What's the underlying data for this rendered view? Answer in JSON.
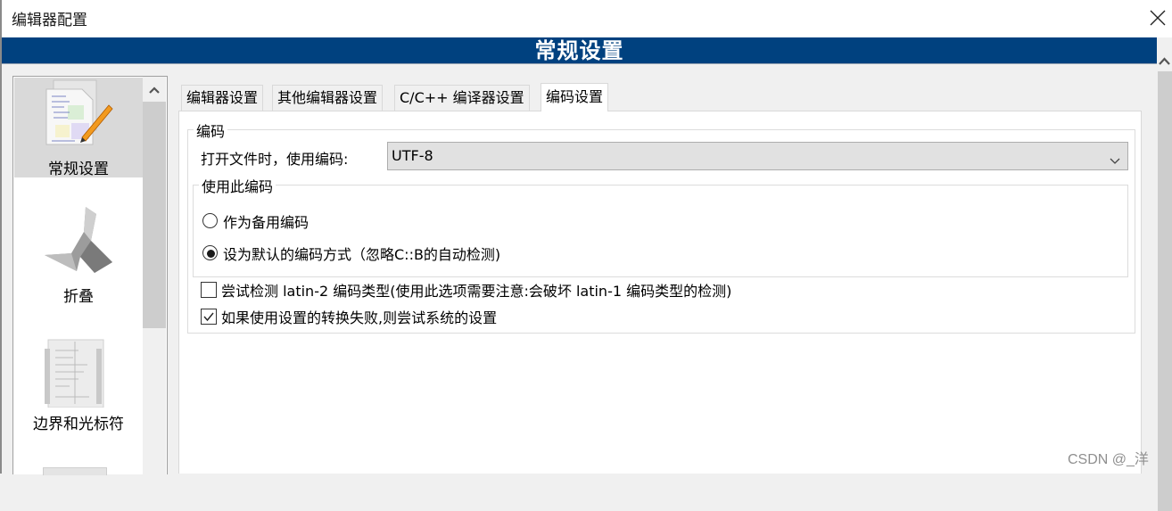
{
  "window": {
    "title": "编辑器配置",
    "close_icon": "close-icon"
  },
  "banner": {
    "title": "常规设置"
  },
  "sidebar": {
    "items": [
      {
        "label": "常规设置",
        "icon": "document-pencil-icon",
        "selected": true
      },
      {
        "label": "折叠",
        "icon": "origami-fold-icon",
        "selected": false
      },
      {
        "label": "边界和光标符",
        "icon": "margin-document-icon",
        "selected": false
      }
    ]
  },
  "tabs": [
    {
      "label": "编辑器设置",
      "active": false
    },
    {
      "label": "其他编辑器设置",
      "active": false
    },
    {
      "label": "C/C++ 编译器设置",
      "active": false
    },
    {
      "label": "编码设置",
      "active": true
    }
  ],
  "encoding": {
    "group_label": "编码",
    "open_file_label": "打开文件时，使用编码:",
    "encoding_value": "UTF-8",
    "use_group_label": "使用此编码",
    "radios": [
      {
        "label": "作为备用编码",
        "checked": false
      },
      {
        "label": "设为默认的编码方式（忽略C::B的自动检测)",
        "checked": true
      }
    ],
    "checkboxes": [
      {
        "label": "尝试检测 latin-2 编码类型(使用此选项需要注意:会破坏 latin-1 编码类型的检测)",
        "checked": false
      },
      {
        "label": "如果使用设置的转换失败,则尝试系统的设置",
        "checked": true
      }
    ]
  },
  "watermark": "CSDN @_洋",
  "colors": {
    "banner": "#00417f",
    "selected_item": "#d9d9d9",
    "combo_bg": "#e1e1e1"
  }
}
